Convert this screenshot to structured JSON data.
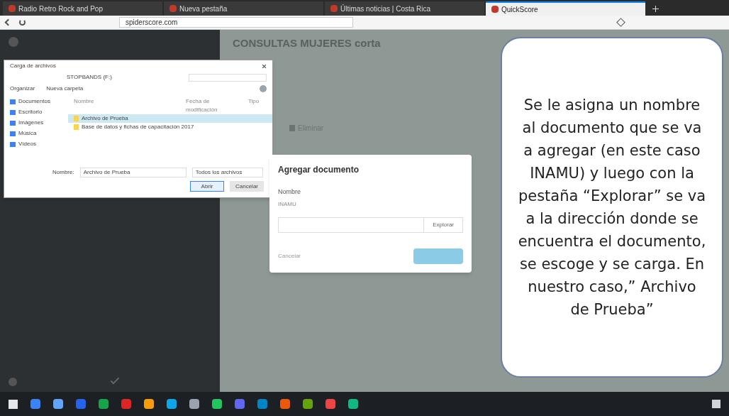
{
  "browser": {
    "tabs": [
      {
        "label": "Radio Retro Rock and Pop",
        "selected": false
      },
      {
        "label": "Nueva pestaña",
        "selected": false
      },
      {
        "label": "Últimas noticias | Costa Rica",
        "selected": false
      },
      {
        "label": "QuickScore",
        "selected": true
      }
    ],
    "address": "spiderscore.com"
  },
  "app": {
    "page_title": "CONSULTAS MUJERES corta",
    "delete_button": "Eliminar"
  },
  "file_dialog": {
    "title": "Carga de archivos",
    "path": "STOPBANDS (F:)",
    "toolbar": [
      "Organizar",
      "Nueva carpeta"
    ],
    "nav_items": [
      "Documentos",
      "Escritorio",
      "Imágenes",
      "Música",
      "Vídeos"
    ],
    "columns": [
      "Nombre",
      "Fecha de modificación",
      "Tipo"
    ],
    "files": [
      {
        "name": "Archivo de Prueba",
        "selected": true
      },
      {
        "name": "Base de datos y fichas de capacitación 2017",
        "selected": false
      }
    ],
    "filename_label": "Nombre:",
    "filename": "Archivo de Prueba",
    "filter": "Todos los archivos",
    "buttons": [
      {
        "label": "Abrir",
        "kind": "primary"
      },
      {
        "label": "Cancelar",
        "kind": "secondary"
      }
    ]
  },
  "modal": {
    "title": "Agregar documento",
    "field_label": "Nombre",
    "field_value": "INAMU",
    "browse_button": "Explorar",
    "cancel_button": "Cancelar"
  },
  "callout": "Se le asigna un nombre al documento que se va a agregar (en este caso INAMU) y luego con la pestaña “Explorar” se va a la dirección donde se encuentra el documento, se escoge y se carga. En nuestro caso,” Archivo de Prueba”"
}
